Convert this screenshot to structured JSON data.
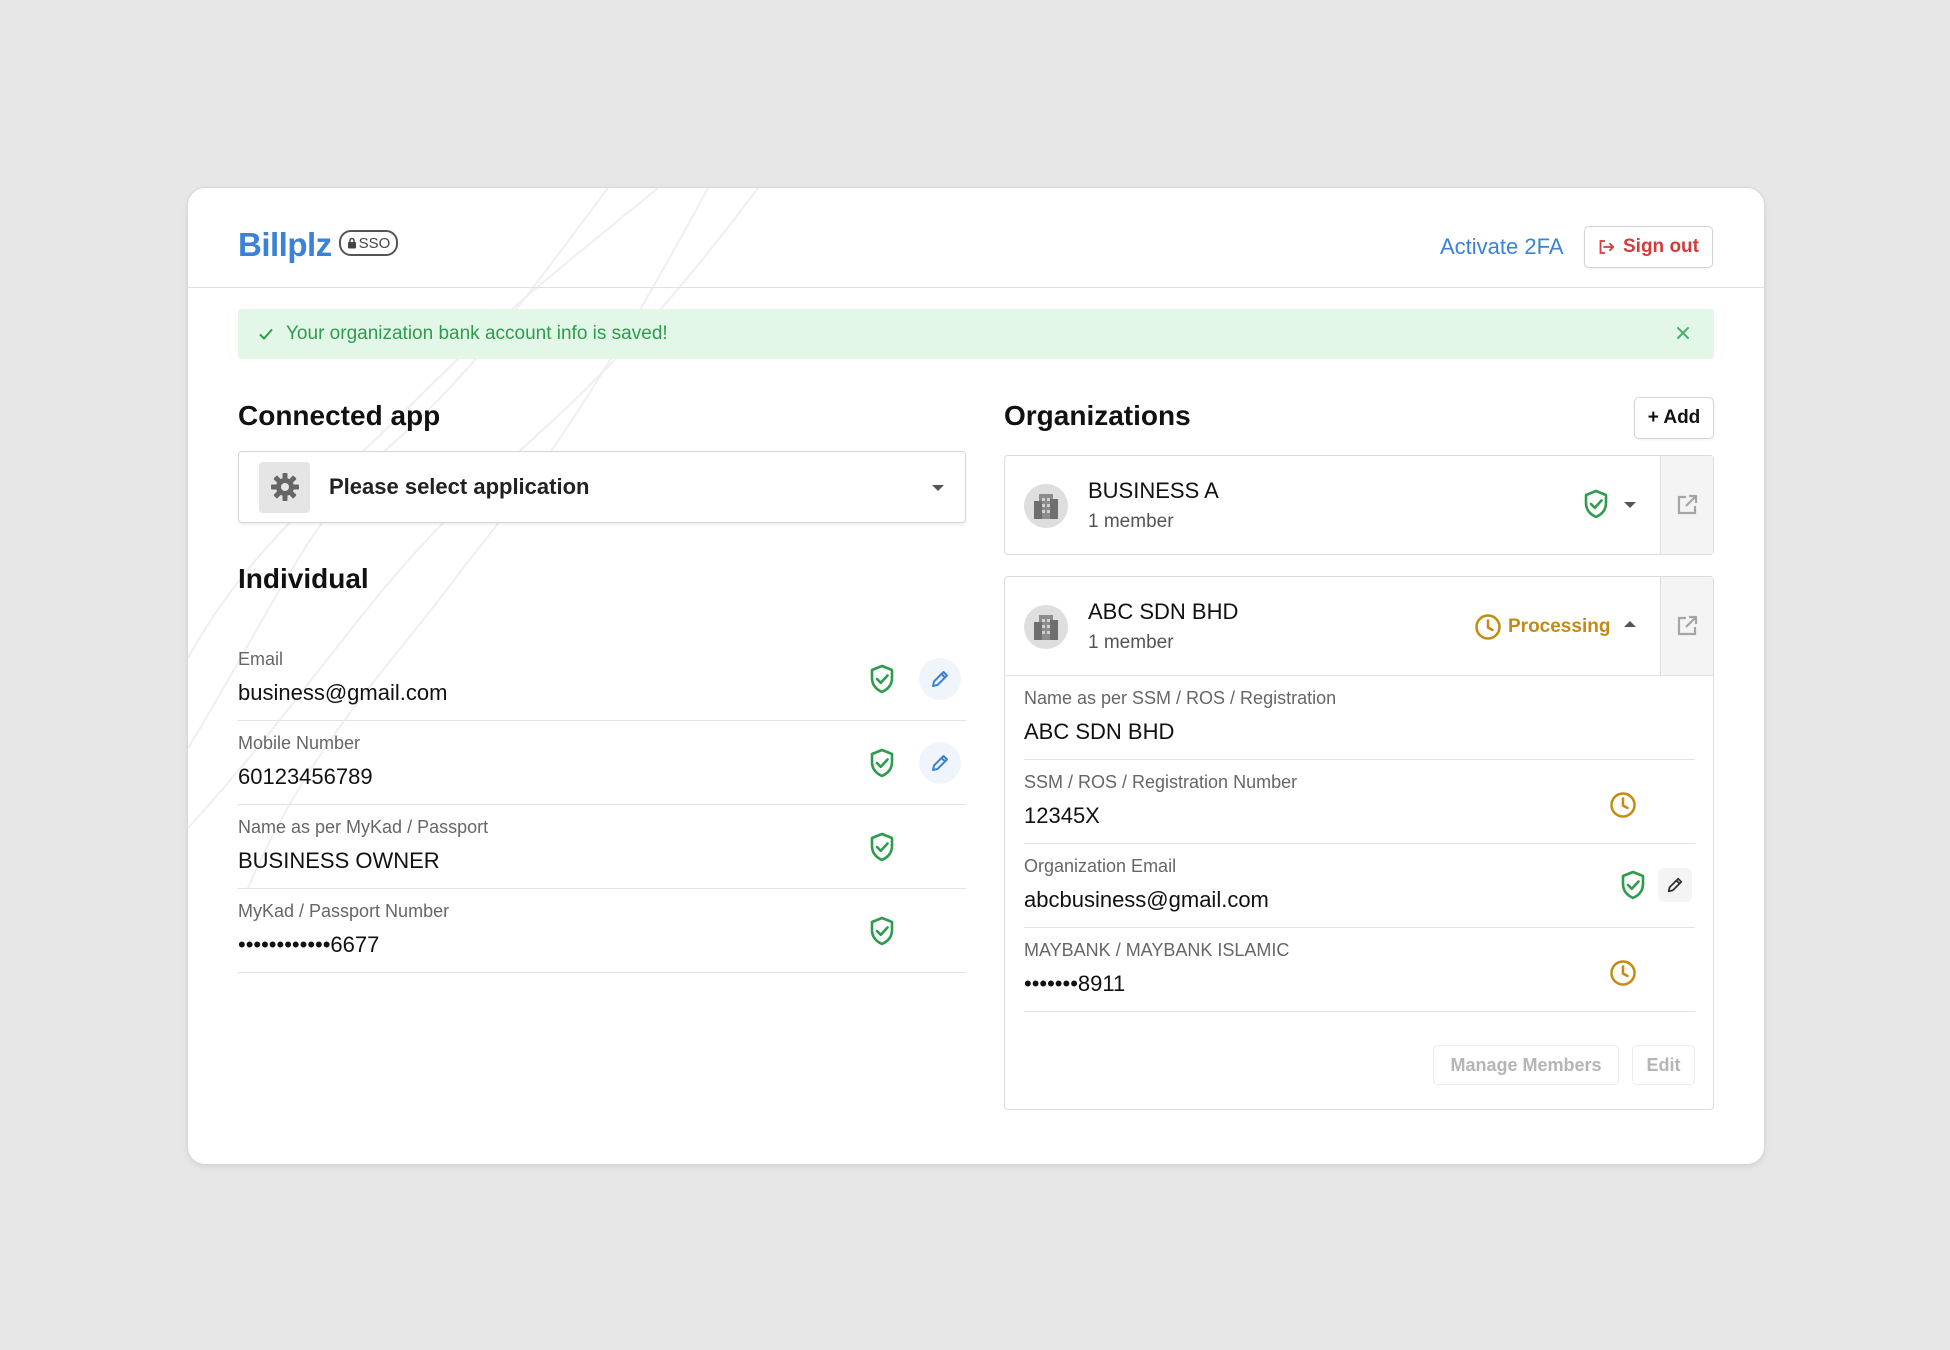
{
  "header": {
    "logo_text": "Billplz",
    "logo_badge": "SSO",
    "activate_2fa": "Activate 2FA",
    "sign_out": "Sign out"
  },
  "alert": {
    "message": "Your organization bank account info is saved!"
  },
  "connected_app": {
    "title": "Connected app",
    "select_placeholder": "Please select application"
  },
  "individual": {
    "title": "Individual",
    "fields": [
      {
        "label": "Email",
        "value": "business@gmail.com",
        "verified": true,
        "editable": true
      },
      {
        "label": "Mobile Number",
        "value": "60123456789",
        "verified": true,
        "editable": true
      },
      {
        "label": "Name as per MyKad / Passport",
        "value": "BUSINESS OWNER",
        "verified": true,
        "editable": false
      },
      {
        "label": "MyKad / Passport Number",
        "value": "••••••••••••6677",
        "verified": true,
        "editable": false
      }
    ]
  },
  "organizations": {
    "title": "Organizations",
    "add_label": "+ Add",
    "items": [
      {
        "name": "BUSINESS A",
        "members": "1 member",
        "status": "verified",
        "expanded": false
      },
      {
        "name": "ABC SDN BHD",
        "members": "1 member",
        "status": "Processing",
        "expanded": true,
        "fields": [
          {
            "label": "Name as per SSM / ROS / Registration",
            "value": "ABC SDN BHD",
            "status": "none"
          },
          {
            "label": "SSM / ROS / Registration Number",
            "value": "12345X",
            "status": "pending"
          },
          {
            "label": "Organization Email",
            "value": "abcbusiness@gmail.com",
            "status": "verified"
          },
          {
            "label": "MAYBANK / MAYBANK ISLAMIC",
            "value": "•••••••8911",
            "status": "pending"
          }
        ],
        "manage_members": "Manage Members",
        "edit": "Edit"
      }
    ]
  },
  "colors": {
    "brand_blue": "#3b82d6",
    "verified_green": "#2e9c4c",
    "pending_amber": "#c58a10",
    "danger_red": "#d43b3b"
  },
  "icons": [
    "lock-icon",
    "sign-out-icon",
    "check-icon",
    "close-icon",
    "gear-icon",
    "chevron-down-icon",
    "chevron-up-icon",
    "shield-check-icon",
    "pencil-icon",
    "building-icon",
    "external-link-icon",
    "clock-icon"
  ]
}
